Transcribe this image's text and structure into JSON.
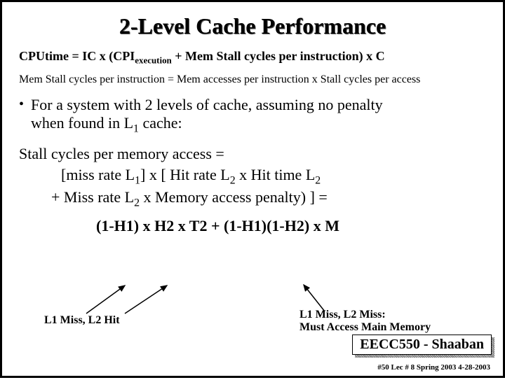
{
  "title": "2-Level Cache Performance",
  "eq_cputime_a": "CPUtime  =  IC x   (CPI",
  "eq_cputime_sub": "execution",
  "eq_cputime_b": "  +  Mem Stall  cycles per instruction)   x   C",
  "eq_memstall": "Mem Stall cycles per instruction =   Mem accesses per instruction  x  Stall cycles per access",
  "bullet_a": "For a system with 2 levels of cache, assuming no penalty",
  "bullet_b": "when found in L",
  "bullet_b_sub": "1",
  "bullet_c": " cache:",
  "stall_head": "Stall cycles per memory access =",
  "stall_l1_a": "[miss rate L",
  "stall_l1_b": "] x  [ Hit rate L",
  "stall_l1_c": "  x Hit time L",
  "stall_l2_a": "+   Miss rate L",
  "stall_l2_b": "  x  Memory access penalty) ]  =",
  "bigeq": "(1-H1) x H2 x T2    +   (1-H1)(1-H2) x M",
  "ann_left": "L1 Miss,  L2  Hit",
  "ann_right_1": "L1 Miss,  L2 Miss:",
  "ann_right_2": "Must Access Main Memory",
  "footer": "EECC550 - Shaaban",
  "tiny": "#50   Lec # 8    Spring 2003   4-28-2003",
  "sub1": "1",
  "sub2": "2"
}
